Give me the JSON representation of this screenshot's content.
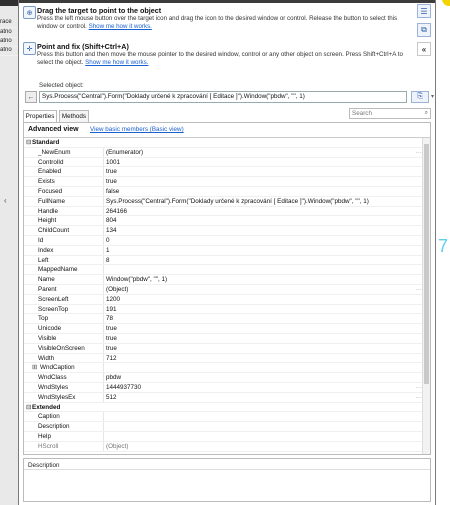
{
  "background": {
    "left_rows": [
      "race",
      "atno",
      "atno",
      "atno"
    ],
    "right_digit": "7"
  },
  "instructions": [
    {
      "title": "Drag the target to point to the object",
      "text": "Press the left mouse button over the target icon and drag the icon to the desired window or control. Release the button to select this window or control.",
      "link": "Show me how it works."
    },
    {
      "title": "Point and fix (Shift+Ctrl+A)",
      "text": "Press this button and then move the mouse pointer to the desired window, control or any other object on screen. Press Shift+Ctrl+A to select the object.",
      "link": "Show me how it works."
    }
  ],
  "selected_object": {
    "label": "Selected object:",
    "value": "Sys.Process(\"Central\").Form(\"Doklady určené k zpracování  [ Editace ]\").Window(\"pbdw\", \"\", 1)"
  },
  "tabs": [
    "Properties",
    "Methods"
  ],
  "search": {
    "placeholder": "Search"
  },
  "view": {
    "advanced": "Advanced view",
    "basic_link": "View basic members (Basic view)"
  },
  "categories": [
    {
      "name": "Standard",
      "rows": [
        {
          "name": "_NewEnum",
          "value": "(Enumerator)",
          "more": true
        },
        {
          "name": "ControlId",
          "value": "1001"
        },
        {
          "name": "Enabled",
          "value": "true"
        },
        {
          "name": "Exists",
          "value": "true"
        },
        {
          "name": "Focused",
          "value": "false"
        },
        {
          "name": "FullName",
          "value": "Sys.Process(\"Central\").Form(\"Doklady určené k zpracování  [ Editace ]\").Window(\"pbdw\", \"\", 1)"
        },
        {
          "name": "Handle",
          "value": "264166"
        },
        {
          "name": "Height",
          "value": "804"
        },
        {
          "name": "ChildCount",
          "value": "134"
        },
        {
          "name": "Id",
          "value": "0"
        },
        {
          "name": "Index",
          "value": "1"
        },
        {
          "name": "Left",
          "value": "8"
        },
        {
          "name": "MappedName",
          "value": ""
        },
        {
          "name": "Name",
          "value": "Window(\"pbdw\", \"\", 1)"
        },
        {
          "name": "Parent",
          "value": "(Object)",
          "more": true
        },
        {
          "name": "ScreenLeft",
          "value": "1200"
        },
        {
          "name": "ScreenTop",
          "value": "191"
        },
        {
          "name": "Top",
          "value": "78"
        },
        {
          "name": "Unicode",
          "value": "true"
        },
        {
          "name": "Visible",
          "value": "true"
        },
        {
          "name": "VisibleOnScreen",
          "value": "true"
        },
        {
          "name": "Width",
          "value": "712"
        },
        {
          "name": "WndCaption",
          "value": "",
          "plus": true
        },
        {
          "name": "WndClass",
          "value": "pbdw"
        },
        {
          "name": "WndStyles",
          "value": "1444937730",
          "more": true
        },
        {
          "name": "WndStylesEx",
          "value": "512",
          "more": true
        }
      ]
    },
    {
      "name": "Extended",
      "rows": [
        {
          "name": "Caption",
          "value": ""
        },
        {
          "name": "Description",
          "value": ""
        },
        {
          "name": "Help",
          "value": ""
        },
        {
          "name": "HScroll",
          "value": "(Object)",
          "dim": true
        }
      ]
    }
  ],
  "description_panel": {
    "label": "Description"
  }
}
